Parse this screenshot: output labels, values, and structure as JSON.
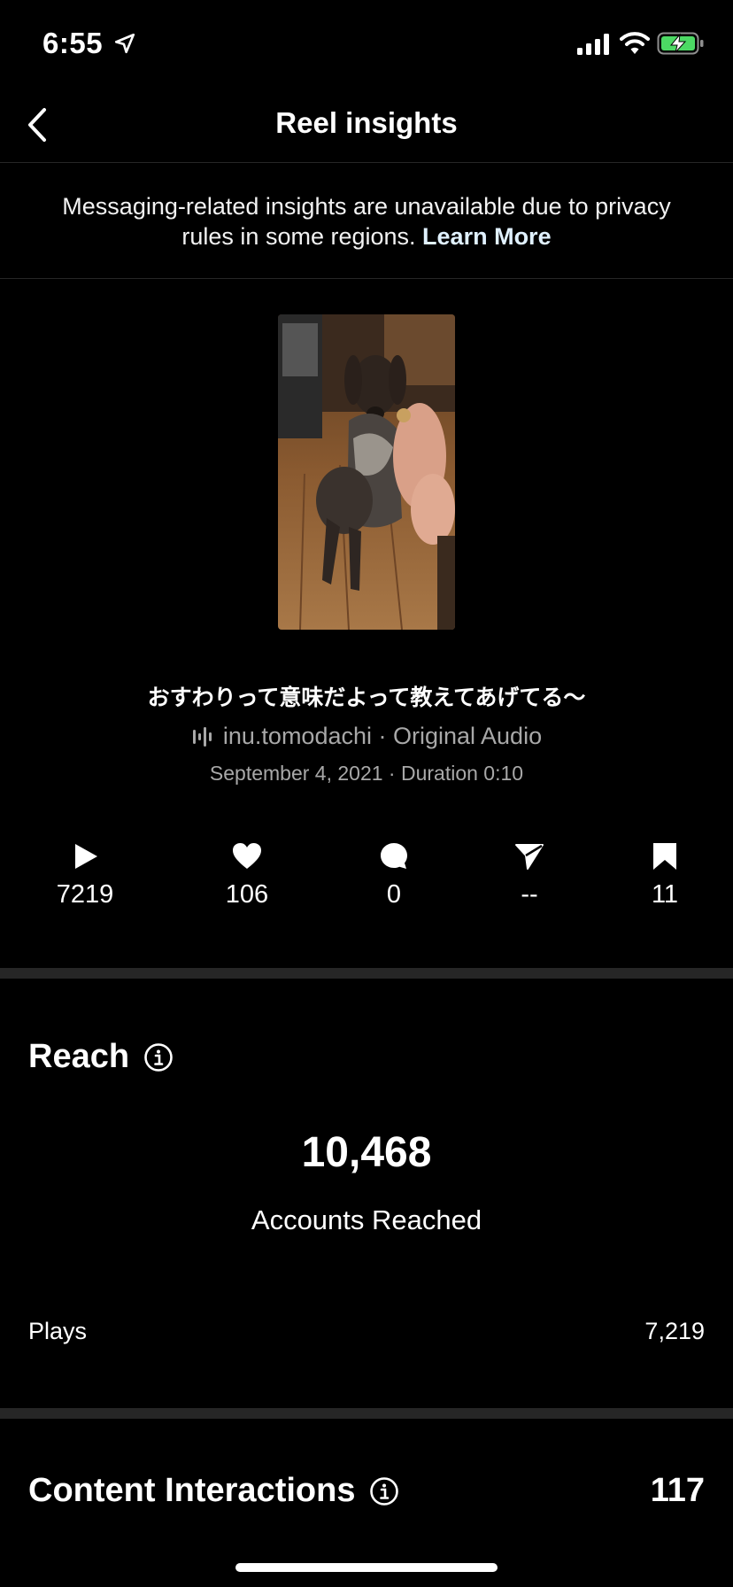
{
  "status_bar": {
    "time": "6:55"
  },
  "nav": {
    "title": "Reel insights"
  },
  "notice": {
    "text": "Messaging-related insights are unavailable due to privacy rules in some regions.",
    "link": "Learn More"
  },
  "reel": {
    "caption": "おすわりって意味だよって教えてあげてる〜",
    "audio": "inu.tomodachi · Original Audio",
    "meta": "September 4, 2021 · Duration 0:10"
  },
  "stats": {
    "plays": "7219",
    "likes": "106",
    "comments": "0",
    "shares": "--",
    "saves": "11"
  },
  "reach": {
    "title": "Reach",
    "value": "10,468",
    "label": "Accounts Reached",
    "plays_label": "Plays",
    "plays_value": "7,219"
  },
  "interactions": {
    "title": "Content Interactions",
    "value": "117"
  },
  "colors": {
    "background": "#000000",
    "divider": "#262626",
    "secondary_text": "#a8a8a8",
    "battery": "#4cd964"
  }
}
